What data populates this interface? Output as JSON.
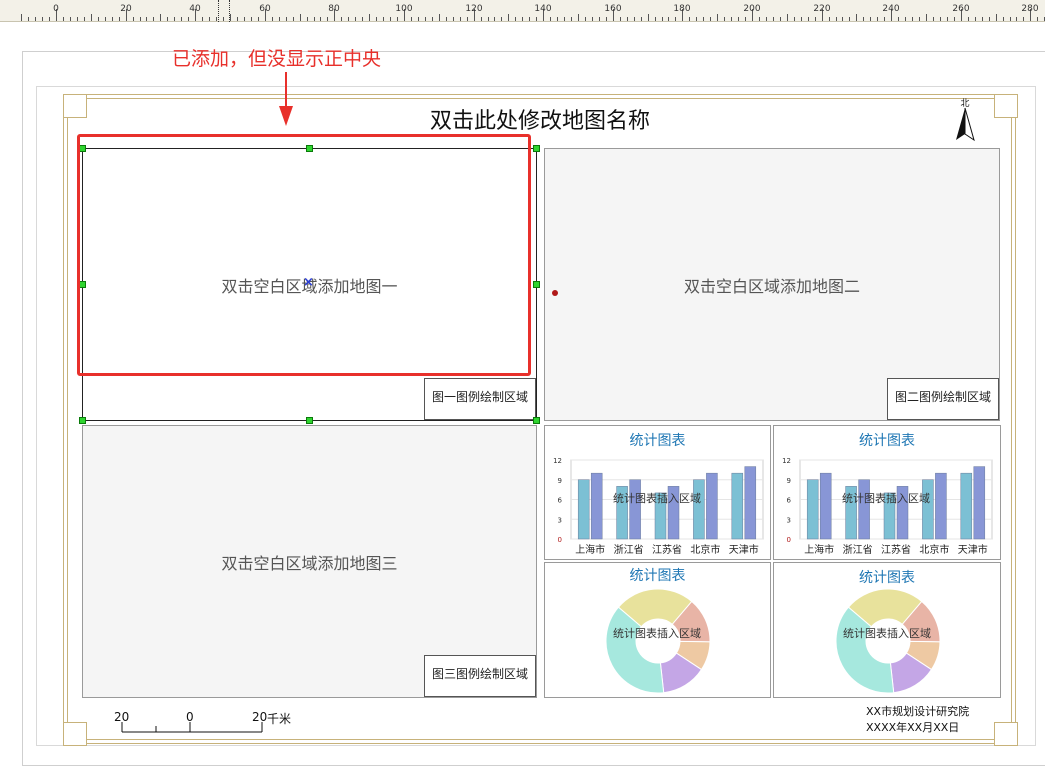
{
  "ruler": {
    "labels": [
      "0",
      "20",
      "40",
      "60",
      "80",
      "100",
      "120",
      "140",
      "160",
      "180",
      "200",
      "220",
      "240",
      "260",
      "280"
    ]
  },
  "annotation": {
    "text": "已添加，但没显示正中央",
    "color": "#e8302b"
  },
  "map_title": "双击此处修改地图名称",
  "north_arrow": {
    "label": "北"
  },
  "map1": {
    "placeholder": "双击空白区域添加地图一",
    "legend": "图一图例绘制区域"
  },
  "map2": {
    "placeholder": "双击空白区域添加地图二",
    "legend": "图二图例绘制区域"
  },
  "map3": {
    "placeholder": "双击空白区域添加地图三",
    "legend": "图三图例绘制区域"
  },
  "charts": {
    "bar1": {
      "title": "统计图表",
      "insert_label": "统计图表插入区域"
    },
    "bar2": {
      "title": "统计图表",
      "insert_label": "统计图表插入区域"
    },
    "pie1": {
      "title": "统计图表",
      "insert_label": "统计图表插入区域"
    },
    "pie2": {
      "title": "统计图表",
      "insert_label": "统计图表插入区域"
    }
  },
  "chart_data": [
    {
      "type": "bar",
      "title": "统计图表",
      "categories": [
        "上海市",
        "浙江省",
        "江苏省",
        "北京市",
        "天津市"
      ],
      "series": [
        {
          "values": [
            9,
            8,
            7,
            9,
            10
          ],
          "color": "#7cc0d4"
        },
        {
          "values": [
            10,
            9,
            8,
            10,
            11
          ],
          "color": "#8896d6"
        }
      ],
      "yticks": [
        "0",
        "3",
        "6",
        "9",
        "12"
      ],
      "ylim": [
        0,
        12
      ]
    },
    {
      "type": "bar",
      "title": "统计图表",
      "categories": [
        "上海市",
        "浙江省",
        "江苏省",
        "北京市",
        "天津市"
      ],
      "series": [
        {
          "values": [
            9,
            8,
            7,
            9,
            10
          ],
          "color": "#7cc0d4"
        },
        {
          "values": [
            10,
            9,
            8,
            10,
            11
          ],
          "color": "#8896d6"
        }
      ],
      "yticks": [
        "0",
        "3",
        "6",
        "9",
        "12"
      ],
      "ylim": [
        0,
        12
      ]
    },
    {
      "type": "pie",
      "title": "统计图表",
      "slices": [
        {
          "value": 25,
          "color": "#e8e29c"
        },
        {
          "value": 14,
          "color": "#e8b4a6"
        },
        {
          "value": 9,
          "color": "#eec9a3"
        },
        {
          "value": 14,
          "color": "#c4a6e6"
        },
        {
          "value": 38,
          "color": "#a6e8de"
        }
      ]
    },
    {
      "type": "pie",
      "title": "统计图表",
      "slices": [
        {
          "value": 25,
          "color": "#e8e29c"
        },
        {
          "value": 14,
          "color": "#e8b4a6"
        },
        {
          "value": 9,
          "color": "#eec9a3"
        },
        {
          "value": 14,
          "color": "#c4a6e6"
        },
        {
          "value": 38,
          "color": "#a6e8de"
        }
      ]
    }
  ],
  "scale_bar": {
    "left": "20",
    "mid": "0",
    "right": "20",
    "unit": "千米"
  },
  "footer": {
    "org": "XX市规划设计研究院",
    "date": "XXXX年XX月XX日"
  }
}
